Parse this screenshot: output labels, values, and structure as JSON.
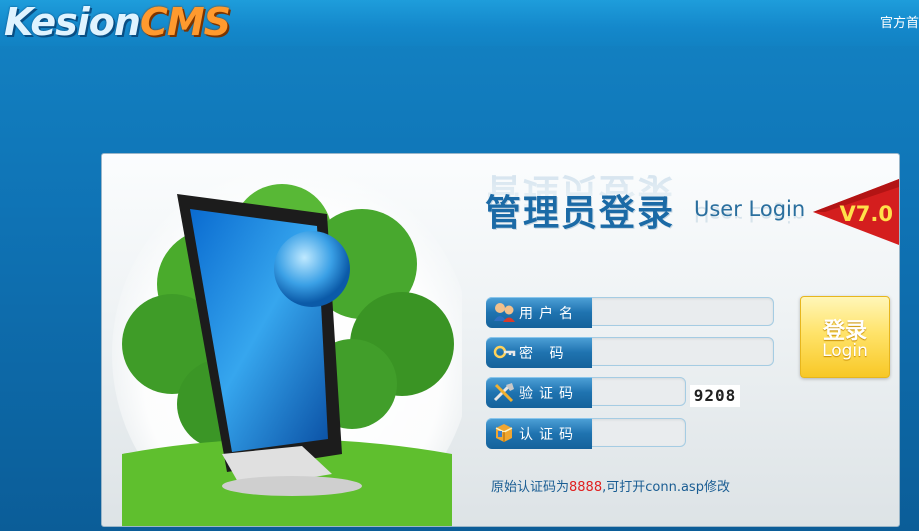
{
  "header": {
    "logo_part1": "Kesion",
    "logo_part2": "CMS",
    "top_link": "官方首"
  },
  "login": {
    "title_cn": "管理员登录",
    "title_en": "User Login",
    "version": "V7.0",
    "fields": {
      "username_label": "用户名",
      "password_label": "密 码",
      "captcha_label": "验证码",
      "authcode_label": "认证码"
    },
    "captcha_value": "9208",
    "submit_cn": "登录",
    "submit_en": "Login",
    "hint_prefix": "原始认证码为",
    "hint_code": "8888",
    "hint_suffix": ",可打开conn.asp修改"
  },
  "icons": {
    "username": "users-icon",
    "password": "key-icon",
    "captcha": "tools-icon",
    "authcode": "package-icon"
  },
  "colors": {
    "background": "#1383c4",
    "field_tag": "#1f73b0",
    "button": "#ffe36a",
    "hint_code": "#e02020"
  }
}
